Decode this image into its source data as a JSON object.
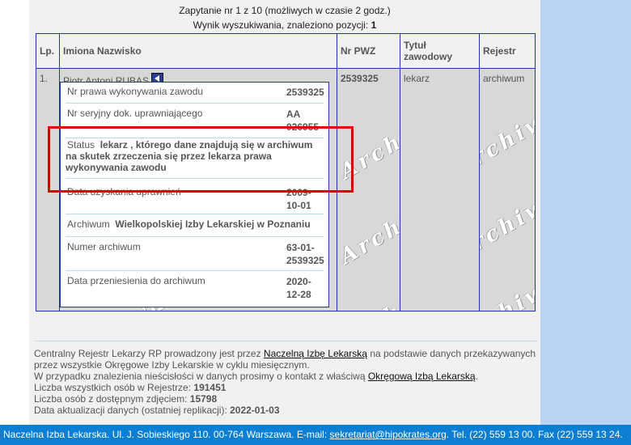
{
  "query": {
    "line1": "Zapytanie nr 1 z 10 (możliwych w czasie 2 godz.)",
    "line2_prefix": "Wynik wyszukiwania, znaleziono pozycji: ",
    "line2_count": "1"
  },
  "table": {
    "headers": {
      "lp": "Lp.",
      "name": "Imiona Nazwisko",
      "pwz": "Nr PWZ",
      "title": "Tytuł zawodowy",
      "registry": "Rejestr"
    },
    "row": {
      "lp": "1.",
      "name": "Piotr Antoni RUBAS",
      "pwz": "2539325",
      "title": "lekarz",
      "registry": "archiwum"
    },
    "watermark": "Archiwum"
  },
  "details": {
    "pwz_label": "Nr prawa wykonywania zawodu",
    "pwz_value": "2539325",
    "serial_label": "Nr seryjny dok. uprawniającego",
    "serial_value_1": "AA",
    "serial_value_2": "026955",
    "status_label": "Status",
    "status_value": "lekarz , którego dane znajdują się w archiwum na skutek zrzeczenia się przez lekarza prawa wykonywania zawodu",
    "date_label": "Data uzyskania uprawnień",
    "date_value_1": "2009-",
    "date_value_2": "10-01",
    "archive_label": "Archiwum",
    "archive_value": "Wielkopolskiej Izby Lekarskiej w Poznaniu",
    "archnum_label": "Numer archiwum",
    "archnum_value_1": "63-01-",
    "archnum_value_2": "2539325",
    "transfer_label": "Data przeniesienia do archiwum",
    "transfer_value_1": "2020-",
    "transfer_value_2": "12-28"
  },
  "footer": {
    "l1_a": "Centralny Rejestr Lekarzy RP prowadzony jest przez ",
    "l1_link": "Naczelną Izbę Lekarską",
    "l1_b": " na podstawie danych przekazywanych",
    "l2": "przez wszystkie Okręgowe Izby Lekarskie w cyklu miesięcznym.",
    "l3_a": "W przypadku znalezienia nieścisłości w danych prosimy o kontakt z właściwą ",
    "l3_link": "Okręgową Izbą Lekarską",
    "l3_b": ".",
    "l4_label": "Liczba wszystkich osób w Rejestrze: ",
    "l4_value": "191451",
    "l5_label": "Liczba osób z dostępnym zdjęciem: ",
    "l5_value": "15798",
    "l6_label": "Data aktualizacji danych (ostatniej replikacji): ",
    "l6_value": "2022-01-03"
  },
  "bottombar": {
    "text_a": "Naczelna Izba Lekarska. Ul. J. Sobieskiego 110. 00-764 Warszawa. E-mail: ",
    "email": "sekretariat@hipokrates.org",
    "text_b": ". Tel. (22) 559 13 00. Fax (22) 559 13 24."
  },
  "colors": {
    "highlight": "#e00000",
    "table_border": "#2233bb",
    "bottombar": "#0c7fd3",
    "side_panel": "#b9d3f2"
  }
}
